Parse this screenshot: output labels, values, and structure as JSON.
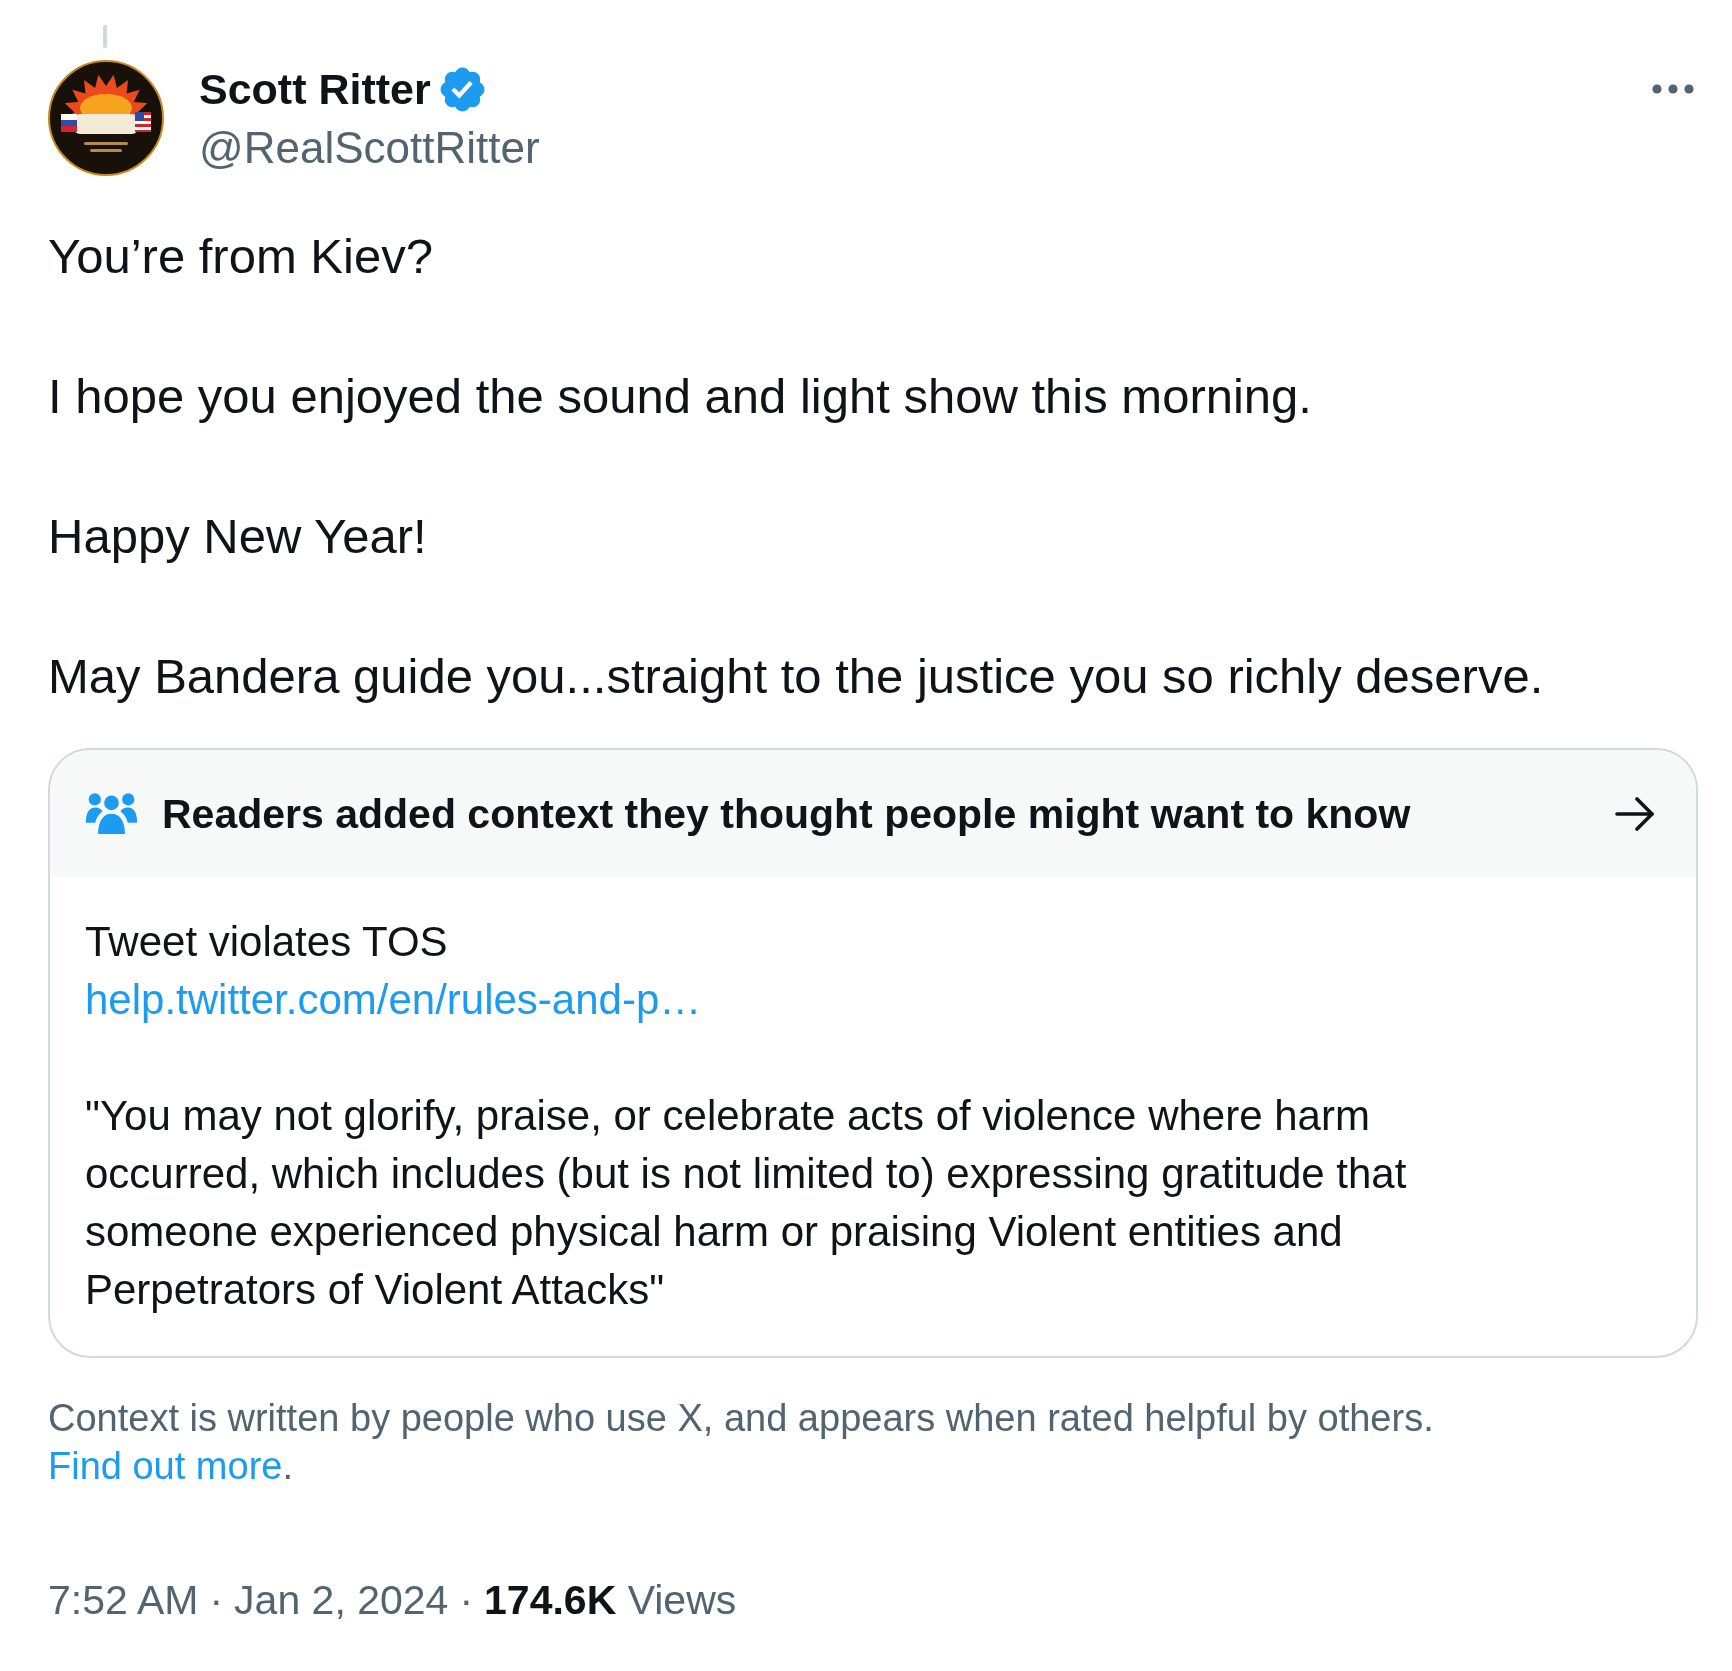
{
  "author": {
    "name": "Scott Ritter",
    "verified": true,
    "handle": "@RealScottRitter"
  },
  "tweet": {
    "paragraphs": [
      "You’re from Kiev?",
      "I hope you enjoyed the sound and light show this morning.",
      "Happy New Year!",
      "May Bandera guide you...straight to the justice you so richly deserve."
    ]
  },
  "community_note": {
    "title": "Readers added context they thought people might want to know",
    "summary": "Tweet violates TOS",
    "link": "help.twitter.com/en/rules-and-p…",
    "quote": "\"You may not glorify, praise, or celebrate acts of violence where harm occurred, which includes (but is not limited to) expressing gratitude that someone experienced physical harm or praising Violent entities and Perpetrators of Violent Attacks\""
  },
  "note_disclaimer": {
    "text": "Context is written by people who use X, and appears when rated helpful by others.",
    "link": "Find out more",
    "end": "."
  },
  "meta": [
    {
      "kind": "time",
      "text": "7:52 AM"
    },
    {
      "kind": "dot",
      "text": "·"
    },
    {
      "kind": "date",
      "text": "Jan 2, 2024"
    },
    {
      "kind": "dot",
      "text": "·"
    },
    {
      "kind": "views",
      "text": "**174.6K** Views"
    }
  ]
}
